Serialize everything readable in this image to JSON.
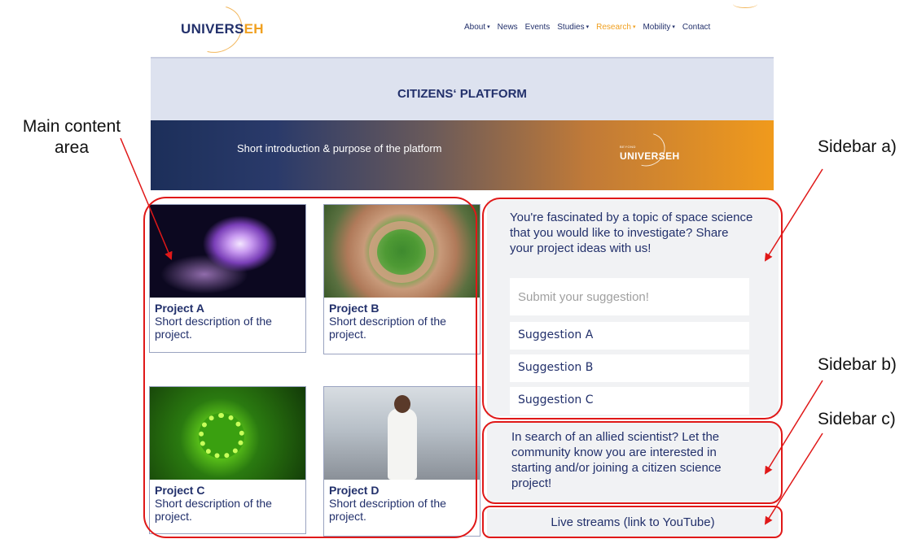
{
  "header": {
    "logo_main": "UNIVERS",
    "logo_accent": "EH",
    "nav": [
      {
        "label": "About",
        "dropdown": true,
        "active": false
      },
      {
        "label": "News",
        "dropdown": false,
        "active": false
      },
      {
        "label": "Events",
        "dropdown": false,
        "active": false
      },
      {
        "label": "Studies",
        "dropdown": true,
        "active": false
      },
      {
        "label": "Research",
        "dropdown": true,
        "active": true
      },
      {
        "label": "Mobility",
        "dropdown": true,
        "active": false
      },
      {
        "label": "Contact",
        "dropdown": false,
        "active": false
      }
    ]
  },
  "title_band": {
    "title": "CITIZENS‘ PLATFORM"
  },
  "banner": {
    "intro": "Short introduction & purpose of the platform",
    "logo_small": "BEYOND",
    "logo_name": "UNIVERSEH"
  },
  "projects": [
    {
      "title": "Project A",
      "description": "Short description of the project.",
      "image": "nebula"
    },
    {
      "title": "Project B",
      "description": "Short description of the project.",
      "image": "hands-circle"
    },
    {
      "title": "Project C",
      "description": "Short description of the project.",
      "image": "virus"
    },
    {
      "title": "Project D",
      "description": "Short description of the project.",
      "image": "laboratory"
    }
  ],
  "sidebar_a": {
    "prompt": "You're fascinated by a topic of space science that you would like to investigate? Share your project ideas with us!",
    "submit_placeholder": "Submit your suggestion!",
    "suggestions": [
      "Suggestion A",
      "Suggestion B",
      "Suggestion C"
    ]
  },
  "sidebar_b": {
    "text": "In search of an allied scientist? Let the community know you are interested in starting and/or joining a citizen science project!"
  },
  "sidebar_c": {
    "text": "Live streams (link to YouTube)"
  },
  "annotations": {
    "main_content": "Main content area",
    "sidebar_a": "Sidebar a)",
    "sidebar_b": "Sidebar b)",
    "sidebar_c": "Sidebar c)"
  },
  "colors": {
    "brand_navy": "#22306b",
    "brand_orange": "#f0a020",
    "annotation_red": "#e01818"
  }
}
